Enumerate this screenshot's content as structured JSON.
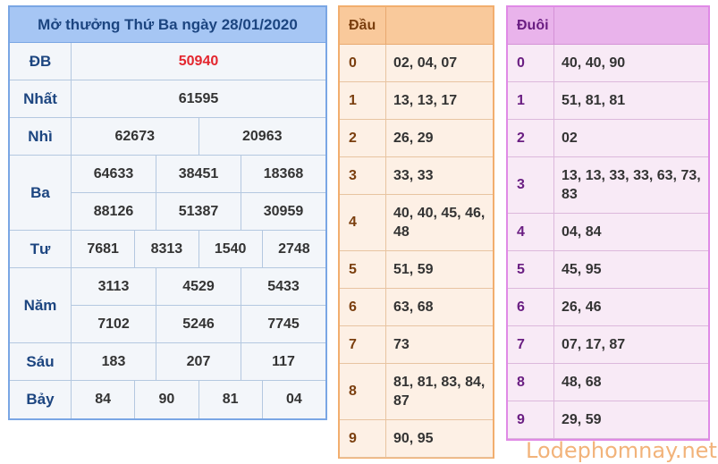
{
  "results": {
    "title": "Mở thưởng Thứ Ba ngày 28/01/2020",
    "rows": [
      {
        "label": "ĐB",
        "lines": [
          [
            "50940"
          ]
        ]
      },
      {
        "label": "Nhất",
        "lines": [
          [
            "61595"
          ]
        ]
      },
      {
        "label": "Nhì",
        "lines": [
          [
            "62673",
            "20963"
          ]
        ]
      },
      {
        "label": "Ba",
        "lines": [
          [
            "64633",
            "38451",
            "18368"
          ],
          [
            "88126",
            "51387",
            "30959"
          ]
        ]
      },
      {
        "label": "Tư",
        "lines": [
          [
            "7681",
            "8313",
            "1540",
            "2748"
          ]
        ]
      },
      {
        "label": "Năm",
        "lines": [
          [
            "3113",
            "4529",
            "5433"
          ],
          [
            "7102",
            "5246",
            "7745"
          ]
        ]
      },
      {
        "label": "Sáu",
        "lines": [
          [
            "183",
            "207",
            "117"
          ]
        ]
      },
      {
        "label": "Bảy",
        "lines": [
          [
            "84",
            "90",
            "81",
            "04"
          ]
        ]
      }
    ]
  },
  "dau": {
    "header": "Đầu",
    "rows": [
      {
        "key": "0",
        "value": "02, 04, 07"
      },
      {
        "key": "1",
        "value": "13, 13, 17"
      },
      {
        "key": "2",
        "value": "26, 29"
      },
      {
        "key": "3",
        "value": "33, 33"
      },
      {
        "key": "4",
        "value": "40, 40, 45, 46, 48"
      },
      {
        "key": "5",
        "value": "51, 59"
      },
      {
        "key": "6",
        "value": "63, 68"
      },
      {
        "key": "7",
        "value": "73"
      },
      {
        "key": "8",
        "value": "81, 81, 83, 84, 87"
      },
      {
        "key": "9",
        "value": "90, 95"
      }
    ]
  },
  "duoi": {
    "header": "Đuôi",
    "rows": [
      {
        "key": "0",
        "value": "40, 40, 90"
      },
      {
        "key": "1",
        "value": "51, 81, 81"
      },
      {
        "key": "2",
        "value": "02"
      },
      {
        "key": "3",
        "value": "13, 13, 33, 33, 63, 73, 83"
      },
      {
        "key": "4",
        "value": "04, 84"
      },
      {
        "key": "5",
        "value": "45, 95"
      },
      {
        "key": "6",
        "value": "26, 46"
      },
      {
        "key": "7",
        "value": "07, 17, 87"
      },
      {
        "key": "8",
        "value": "48, 68"
      },
      {
        "key": "9",
        "value": "29, 59"
      }
    ]
  },
  "watermark": "Lodephomnay.net",
  "colors": {
    "special_prize": "#e3262e",
    "results_header": "#a6c6f4",
    "dau_header": "#f9c99b",
    "duoi_header": "#e9b3eb"
  }
}
